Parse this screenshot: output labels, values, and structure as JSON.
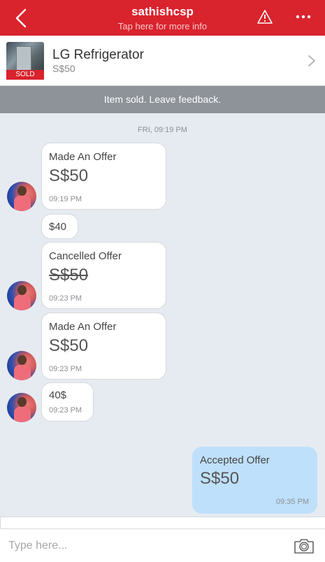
{
  "header": {
    "username": "sathishcsp",
    "subtitle": "Tap here for more info",
    "back_icon": "chevron-left-icon",
    "warning_icon": "warning-icon",
    "more_icon": "more-horizontal-icon"
  },
  "listing": {
    "title": "LG Refrigerator",
    "price": "S$50",
    "badge": "SOLD"
  },
  "banner": {
    "text": "Item sold. Leave feedback."
  },
  "chat": {
    "date": "FRI, 09:19 PM",
    "messages": [
      {
        "label": "Made An Offer",
        "amount": "S$50",
        "time": "09:19 PM"
      },
      {
        "text": "$40"
      },
      {
        "label": "Cancelled Offer",
        "amount": "S$50",
        "time": "09:23 PM"
      },
      {
        "label": "Made An Offer",
        "amount": "S$50",
        "time": "09:23 PM"
      },
      {
        "text": "40$",
        "time": "09:23 PM"
      },
      {
        "label": "Accepted Offer",
        "amount": "S$50",
        "time": "09:35 PM"
      }
    ]
  },
  "composer": {
    "placeholder": "Type here...",
    "camera_icon": "camera-icon"
  },
  "colors": {
    "brand": "#d9232d",
    "background": "#e6ebf1",
    "own_bubble": "#bfe0fa",
    "banner": "#8e9399"
  }
}
